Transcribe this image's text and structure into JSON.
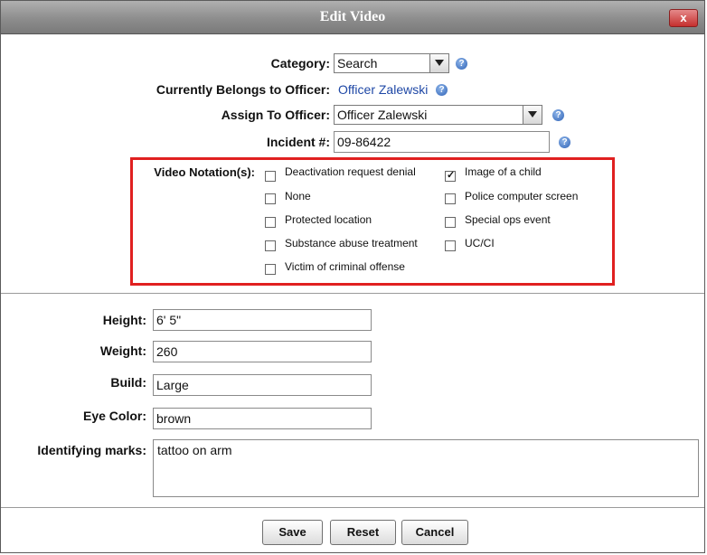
{
  "dialog": {
    "title": "Edit Video",
    "close_label": "x"
  },
  "form": {
    "category_label": "Category:",
    "category_value": "Search",
    "currently_belongs_label": "Currently Belongs to Officer:",
    "currently_belongs_value": "Officer Zalewski",
    "assign_label": "Assign To Officer:",
    "assign_value": "Officer Zalewski",
    "incident_label": "Incident #:",
    "incident_value": "09-86422"
  },
  "notations": {
    "label": "Video Notation(s):",
    "items": [
      {
        "label": "Deactivation request denial",
        "checked": false
      },
      {
        "label": "None",
        "checked": false
      },
      {
        "label": "Protected location",
        "checked": false
      },
      {
        "label": "Substance abuse treatment",
        "checked": false
      },
      {
        "label": "Victim of criminal offense",
        "checked": false
      },
      {
        "label": "Image of a child",
        "checked": true
      },
      {
        "label": "Police computer screen",
        "checked": false
      },
      {
        "label": "Special ops event",
        "checked": false
      },
      {
        "label": "UC/CI",
        "checked": false
      }
    ]
  },
  "details": {
    "height_label": "Height:",
    "height_value": "6' 5\"",
    "weight_label": "Weight:",
    "weight_value": "260",
    "build_label": "Build:",
    "build_value": "Large",
    "eye_label": "Eye Color:",
    "eye_value": "brown",
    "marks_label": "Identifying marks:",
    "marks_value": "tattoo on arm"
  },
  "buttons": {
    "save": "Save",
    "reset": "Reset",
    "cancel": "Cancel"
  },
  "icons": {
    "help": "help-question-icon",
    "close": "close-icon",
    "dropdown": "chevron-down-icon",
    "check": "checkmark-icon"
  },
  "colors": {
    "highlight_border": "#e02020",
    "link": "#1f48a6",
    "close_button": "#c5302e"
  }
}
